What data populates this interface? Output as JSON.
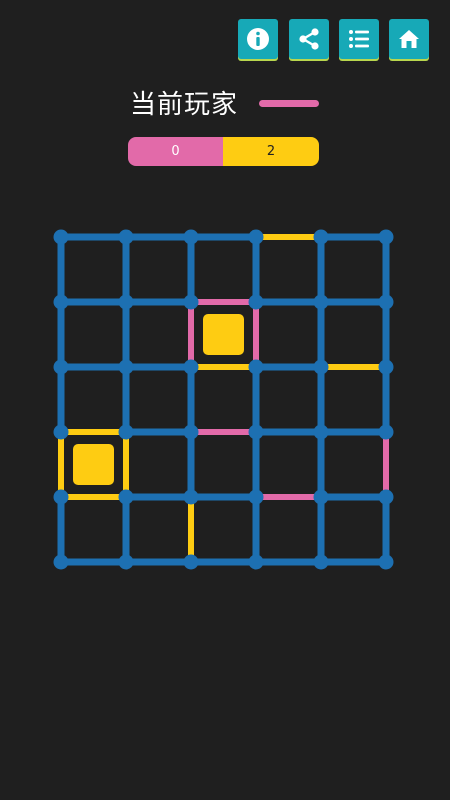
{
  "toolbar": {
    "buttons": [
      {
        "name": "info-button",
        "icon": "info-icon"
      },
      {
        "name": "share-button",
        "icon": "share-icon"
      },
      {
        "name": "list-button",
        "icon": "list-icon"
      },
      {
        "name": "home-button",
        "icon": "home-icon"
      }
    ]
  },
  "status": {
    "current_player_label": "当前玩家",
    "current_player_color": "#e26aa9"
  },
  "score": {
    "player1": "0",
    "player2": "2",
    "player1_color": "#e26aa9",
    "player2_color": "#fecc12"
  },
  "board": {
    "rows": 5,
    "cols": 5,
    "colors": {
      "empty": "#1d70b2",
      "dot": "#1d70b2",
      "pink": "#e26aa9",
      "yellow": "#fecc12"
    },
    "h_edges": [
      [
        "empty",
        "empty",
        "empty",
        "yellow",
        "empty"
      ],
      [
        "empty",
        "empty",
        "pink",
        "empty",
        "empty"
      ],
      [
        "empty",
        "empty",
        "yellow",
        "empty",
        "yellow"
      ],
      [
        "yellow",
        "empty",
        "pink",
        "empty",
        "empty"
      ],
      [
        "yellow",
        "empty",
        "empty",
        "pink",
        "empty"
      ],
      [
        "empty",
        "empty",
        "empty",
        "empty",
        "empty"
      ]
    ],
    "v_edges": [
      [
        "empty",
        "empty",
        "empty",
        "empty",
        "empty",
        "empty"
      ],
      [
        "empty",
        "empty",
        "pink",
        "pink",
        "empty",
        "empty"
      ],
      [
        "empty",
        "empty",
        "empty",
        "empty",
        "empty",
        "empty"
      ],
      [
        "yellow",
        "yellow",
        "empty",
        "empty",
        "empty",
        "pink"
      ],
      [
        "empty",
        "empty",
        "yellow",
        "empty",
        "empty",
        "empty"
      ]
    ],
    "boxes": [
      [
        "none",
        "none",
        "none",
        "none",
        "none"
      ],
      [
        "none",
        "none",
        "yellow",
        "none",
        "none"
      ],
      [
        "none",
        "none",
        "none",
        "none",
        "none"
      ],
      [
        "yellow",
        "none",
        "none",
        "none",
        "none"
      ],
      [
        "none",
        "none",
        "none",
        "none",
        "none"
      ]
    ]
  }
}
